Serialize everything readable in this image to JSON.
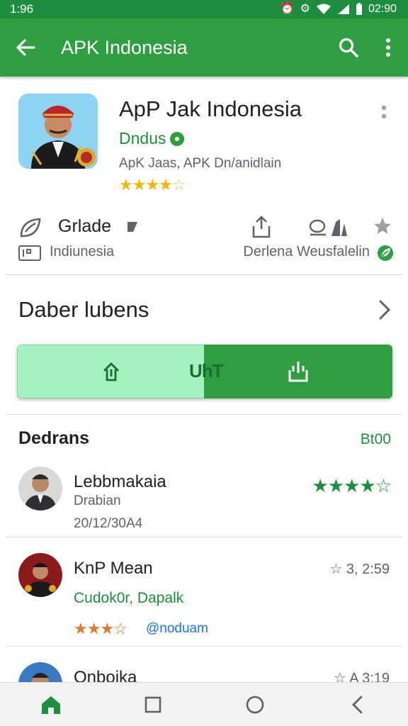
{
  "status_bar": {
    "time": "1:96",
    "clock_right": "02:90"
  },
  "app_bar": {
    "title": "APK Indonesia"
  },
  "app": {
    "name": "ApP Jak Indonesia",
    "developer": "Dndus",
    "subtitle": "ApK Jaas, APK Dn/anidlain",
    "rating_stars": 4,
    "rating_max": 5,
    "grade_label": "Grlade",
    "region": "Indiunesia",
    "downloads": "Derlena Weusfalelin"
  },
  "section": {
    "label": "Daber lubens"
  },
  "buttons": {
    "middle_label": "UhT"
  },
  "reviews": {
    "title": "Dedrans",
    "count": "Bt00",
    "items": [
      {
        "name": "Lebbmakaia",
        "line2": "Drabian",
        "line3": "20/12/30A4",
        "stars_filled": 4,
        "stars_max": 5
      },
      {
        "name": "KnP Mean",
        "line2": "Cudok0r, Dapalk",
        "stars_filled": 3,
        "stars_max": 5,
        "handle": "@noduam",
        "meta": "3, 2:59"
      },
      {
        "name": "Onboika",
        "meta": "A 3:19"
      }
    ]
  },
  "colors": {
    "brand_green": "#2e9e40",
    "status_green": "#1e8e3e",
    "light_green": "#a6f2bf",
    "star_gold": "#f2b705",
    "star_orange": "#e0792c"
  },
  "icons": {
    "back": "arrow-back-icon",
    "search": "search-icon",
    "more": "more-vert-icon",
    "home": "home-icon",
    "recents": "square-icon",
    "circle": "circle-icon",
    "nav_back": "chevron-left-icon"
  }
}
